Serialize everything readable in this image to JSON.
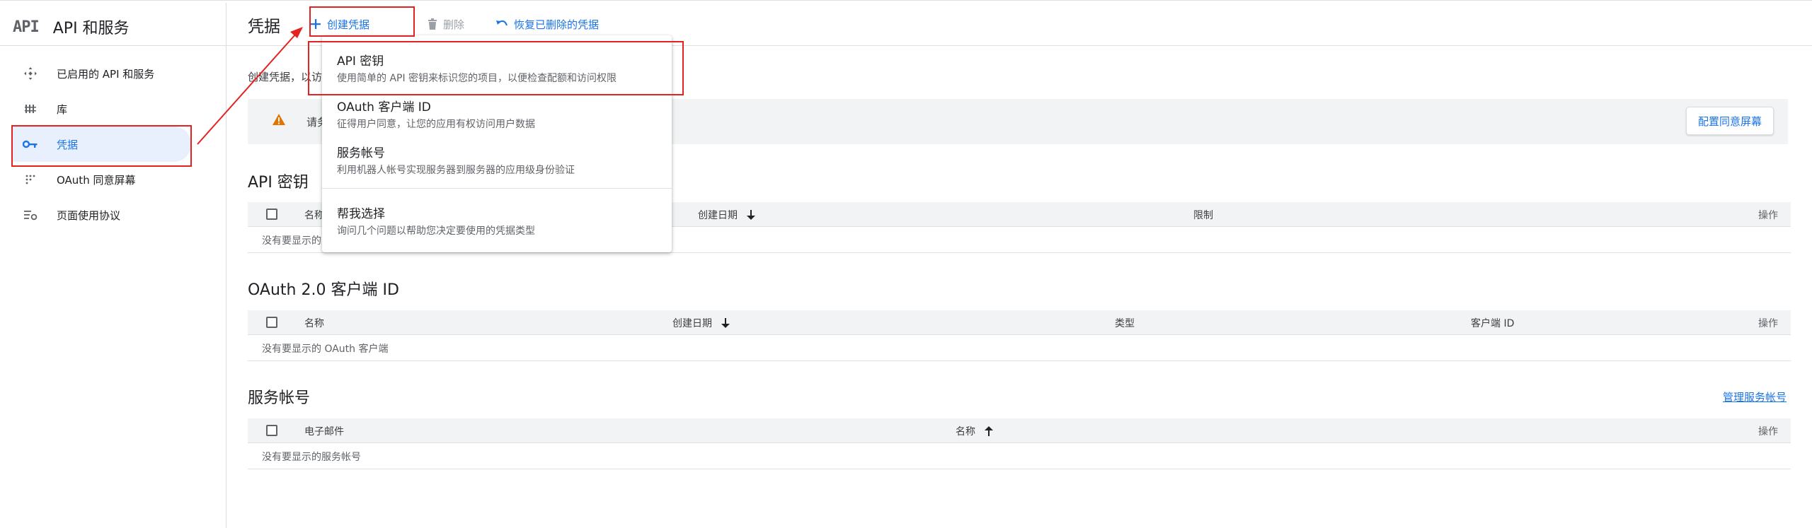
{
  "app": {
    "logo_text": "API",
    "title": "API 和服务"
  },
  "sidebar": {
    "items": [
      {
        "label": "已启用的 API 和服务",
        "icon": "api-hub-icon"
      },
      {
        "label": "库",
        "icon": "library-icon"
      },
      {
        "label": "凭据",
        "icon": "key-icon",
        "active": true
      },
      {
        "label": "OAuth 同意屏幕",
        "icon": "consent-grid-icon"
      },
      {
        "label": "页面使用协议",
        "icon": "settings-list-icon"
      }
    ]
  },
  "toolbar": {
    "page_title": "凭据",
    "create_label": "创建凭据",
    "delete_label": "删除",
    "restore_label": "恢复已删除的凭据"
  },
  "main": {
    "intro_text": "创建凭据，以访",
    "banner_text": "请务",
    "banner_button": "配置同意屏幕"
  },
  "create_menu": {
    "items": [
      {
        "title": "API 密钥",
        "desc": "使用简单的 API 密钥来标识您的项目，以便检查配额和访问权限"
      },
      {
        "title": "OAuth 客户端 ID",
        "desc": "征得用户同意，让您的应用有权访问用户数据"
      },
      {
        "title": "服务帐号",
        "desc": "利用机器人帐号实现服务器到服务器的应用级身份验证"
      },
      {
        "title": "帮我选择",
        "desc": "询问几个问题以帮助您决定要使用的凭据类型"
      }
    ]
  },
  "api_keys": {
    "title": "API 密钥",
    "columns": {
      "name": "名称",
      "created": "创建日期",
      "restrictions": "限制",
      "actions": "操作"
    },
    "empty_text": "没有要显示的"
  },
  "oauth_clients": {
    "title": "OAuth 2.0 客户端 ID",
    "columns": {
      "name": "名称",
      "created": "创建日期",
      "type": "类型",
      "client_id": "客户端 ID",
      "actions": "操作"
    },
    "empty_text": "没有要显示的 OAuth 客户端"
  },
  "service_accounts": {
    "title": "服务帐号",
    "manage_link": "管理服务帐号",
    "columns": {
      "email": "电子邮件",
      "name": "名称",
      "actions": "操作"
    },
    "empty_text": "没有要显示的服务帐号"
  },
  "colors": {
    "accent": "#1a73e8",
    "active_bg": "#e8f0fe",
    "warning": "#e37400",
    "annotation": "#e52222"
  }
}
